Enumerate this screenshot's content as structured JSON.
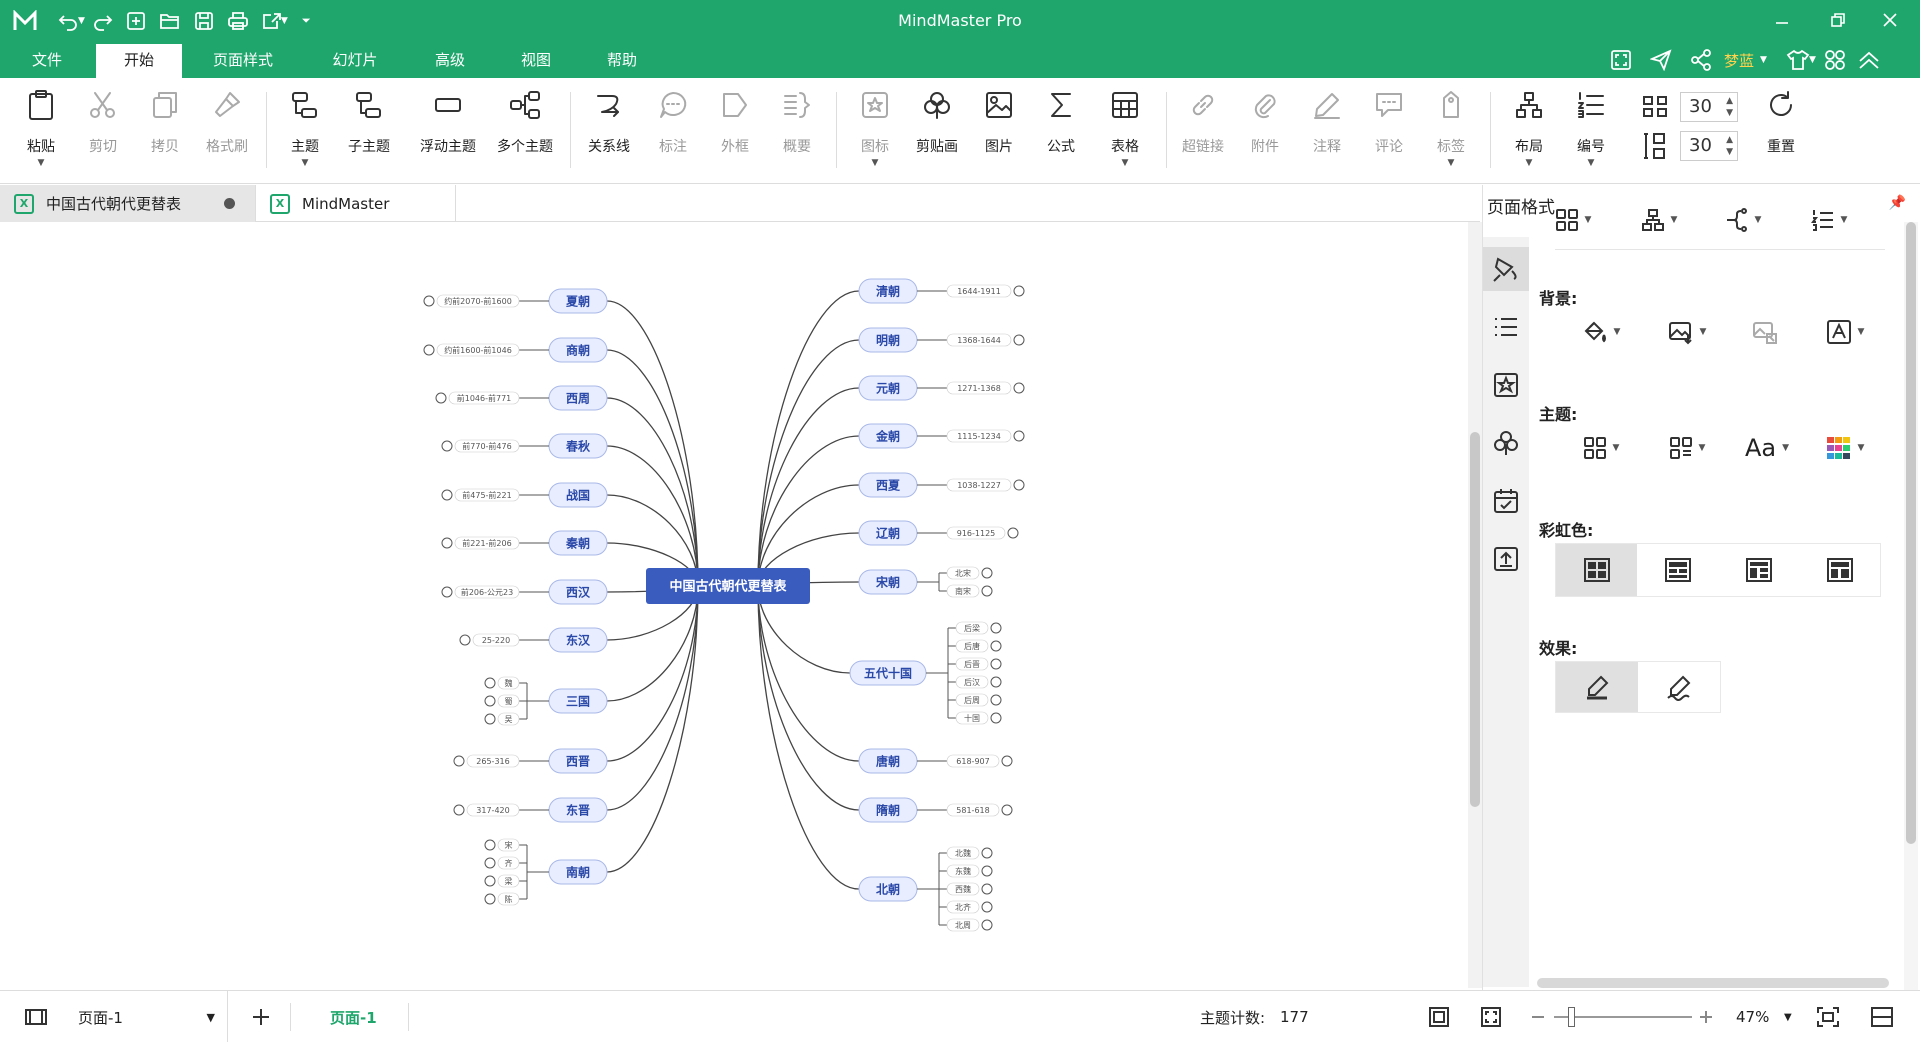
{
  "app": {
    "title": "MindMaster Pro",
    "user": "梦蓝"
  },
  "menu": [
    "文件",
    "开始",
    "页面样式",
    "幻灯片",
    "高级",
    "视图",
    "帮助"
  ],
  "toolbar": {
    "paste": "粘贴",
    "cut": "剪切",
    "copy": "拷贝",
    "format_painter": "格式刷",
    "topic": "主题",
    "subtopic": "子主题",
    "floating_topic": "浮动主题",
    "multi_topic": "多个主题",
    "relationship": "关系线",
    "callout": "标注",
    "boundary": "外框",
    "summary": "概要",
    "icon": "图标",
    "clipart": "剪贴画",
    "image": "图片",
    "formula": "公式",
    "table": "表格",
    "hyperlink": "超链接",
    "attachment": "附件",
    "note": "注释",
    "comment": "评论",
    "tag": "标签",
    "layout": "布局",
    "numbering": "编号",
    "h_spacing": "30",
    "v_spacing": "30",
    "reset": "重置"
  },
  "tabs": [
    {
      "label": "中国古代朝代更替表"
    },
    {
      "label": "MindMaster"
    }
  ],
  "mindmap": {
    "root": "中国古代朝代更替表",
    "left": [
      {
        "name": "夏朝",
        "children": [
          "约前2070-前1600"
        ]
      },
      {
        "name": "商朝",
        "children": [
          "约前1600-前1046"
        ]
      },
      {
        "name": "西周",
        "children": [
          "前1046-前771"
        ]
      },
      {
        "name": "春秋",
        "children": [
          "前770-前476"
        ]
      },
      {
        "name": "战国",
        "children": [
          "前475-前221"
        ]
      },
      {
        "name": "秦朝",
        "children": [
          "前221-前206"
        ]
      },
      {
        "name": "西汉",
        "children": [
          "前206-公元23"
        ]
      },
      {
        "name": "东汉",
        "children": [
          "25-220"
        ]
      },
      {
        "name": "三国",
        "children": [
          "魏",
          "蜀",
          "吴"
        ]
      },
      {
        "name": "西晋",
        "children": [
          "265-316"
        ]
      },
      {
        "name": "东晋",
        "children": [
          "317-420"
        ]
      },
      {
        "name": "南朝",
        "children": [
          "宋",
          "齐",
          "梁",
          "陈"
        ]
      }
    ],
    "right": [
      {
        "name": "清朝",
        "children": [
          "1644-1911"
        ]
      },
      {
        "name": "明朝",
        "children": [
          "1368-1644"
        ]
      },
      {
        "name": "元朝",
        "children": [
          "1271-1368"
        ]
      },
      {
        "name": "金朝",
        "children": [
          "1115-1234"
        ]
      },
      {
        "name": "西夏",
        "children": [
          "1038-1227"
        ]
      },
      {
        "name": "辽朝",
        "children": [
          "916-1125"
        ]
      },
      {
        "name": "宋朝",
        "children": [
          "北宋",
          "南宋"
        ]
      },
      {
        "name": "五代十国",
        "children": [
          "后梁",
          "后唐",
          "后晋",
          "后汉",
          "后周",
          "十国"
        ]
      },
      {
        "name": "唐朝",
        "children": [
          "618-907"
        ]
      },
      {
        "name": "隋朝",
        "children": [
          "581-618"
        ]
      },
      {
        "name": "北朝",
        "children": [
          "北魏",
          "东魏",
          "西魏",
          "北齐",
          "北周"
        ]
      }
    ]
  },
  "panel": {
    "title": "页面格式",
    "background_label": "背景:",
    "theme_label": "主题:",
    "rainbow_label": "彩虹色:",
    "effect_label": "效果:",
    "theme_font": "Aa"
  },
  "status": {
    "page_select": "页面-1",
    "page_tab": "页面-1",
    "topic_count_label": "主题计数:",
    "topic_count": "177",
    "zoom": "47%"
  },
  "colors": {
    "brand": "#1fa66c",
    "root_fill": "#3b5cbf",
    "node_fill": "#e8eeff",
    "node_stroke": "#a9b8e8",
    "node_text": "#2a48a8",
    "user_name": "#ffd34d"
  }
}
